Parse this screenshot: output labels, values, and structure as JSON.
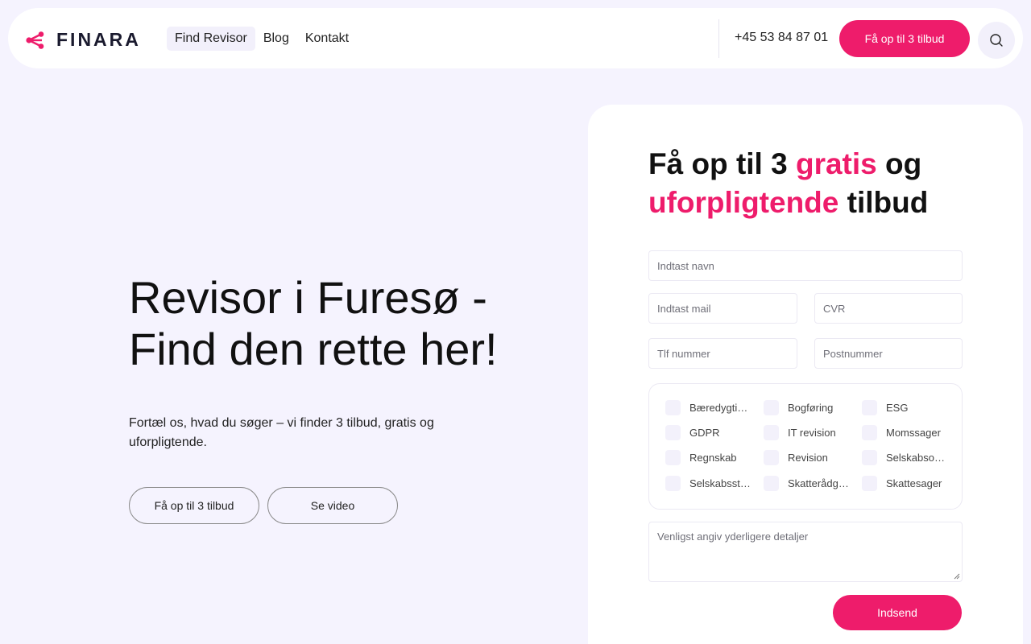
{
  "header": {
    "logo_text": "FINARA",
    "nav": [
      {
        "label": "Find Revisor"
      },
      {
        "label": "Blog"
      },
      {
        "label": "Kontakt"
      }
    ],
    "phone": "+45 53 84 87 01",
    "cta_label": "Få op til 3 tilbud",
    "search_icon": "search-icon"
  },
  "hero": {
    "title_line1": "Revisor i Furesø -",
    "title_line2": "Find den rette her!",
    "subtitle": "Fortæl os, hvad du søger – vi finder 3 tilbud, gratis og uforpligtende.",
    "primary_button": "Få op til 3 tilbud",
    "secondary_button": "Se video"
  },
  "form": {
    "title_part1": "Få op til 3 ",
    "title_pink1": "gratis",
    "title_part2": " og",
    "title_pink2": "uforpligtende",
    "title_part3": " tilbud",
    "fields": {
      "name_placeholder": "Indtast navn",
      "mail_placeholder": "Indtast mail",
      "cvr_placeholder": "CVR",
      "phone_placeholder": "Tlf nummer",
      "zip_placeholder": "Postnummer"
    },
    "checkboxes": [
      "Bæredygtighed",
      "Bogføring",
      "ESG",
      "GDPR",
      "IT revision",
      "Momssager",
      "Regnskab",
      "Revision",
      "Selskabsomdannelse",
      "Selskabsstiftelse",
      "Skatterådgivning",
      "Skattesager"
    ],
    "details_placeholder": "Venligst angiv yderligere detaljer",
    "submit_label": "Indsend"
  },
  "colors": {
    "accent": "#ee1c6b",
    "background": "#f5f3fe"
  }
}
